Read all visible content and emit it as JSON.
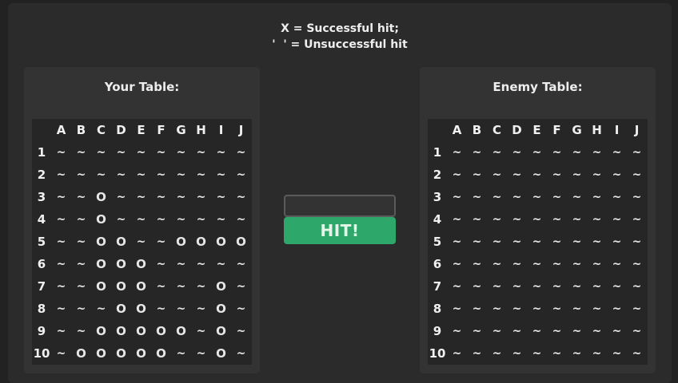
{
  "legend": {
    "line1": "X = Successful hit;",
    "line2": "'  ' = Unsuccessful hit"
  },
  "columns": [
    "A",
    "B",
    "C",
    "D",
    "E",
    "F",
    "G",
    "H",
    "I",
    "J"
  ],
  "rows": [
    "1",
    "2",
    "3",
    "4",
    "5",
    "6",
    "7",
    "8",
    "9",
    "10"
  ],
  "your_table": {
    "title": "Your Table:",
    "grid": [
      [
        "~",
        "~",
        "~",
        "~",
        "~",
        "~",
        "~",
        "~",
        "~",
        "~"
      ],
      [
        "~",
        "~",
        "~",
        "~",
        "~",
        "~",
        "~",
        "~",
        "~",
        "~"
      ],
      [
        "~",
        "~",
        "O",
        "~",
        "~",
        "~",
        "~",
        "~",
        "~",
        "~"
      ],
      [
        "~",
        "~",
        "O",
        "~",
        "~",
        "~",
        "~",
        "~",
        "~",
        "~"
      ],
      [
        "~",
        "~",
        "O",
        "O",
        "~",
        "~",
        "O",
        "O",
        "O",
        "O"
      ],
      [
        "~",
        "~",
        "O",
        "O",
        "O",
        "~",
        "~",
        "~",
        "~",
        "~"
      ],
      [
        "~",
        "~",
        "O",
        "O",
        "O",
        "~",
        "~",
        "~",
        "O",
        "~"
      ],
      [
        "~",
        "~",
        "~",
        "O",
        "O",
        "~",
        "~",
        "~",
        "O",
        "~"
      ],
      [
        "~",
        "~",
        "O",
        "O",
        "O",
        "O",
        "O",
        "~",
        "O",
        "~"
      ],
      [
        "~",
        "O",
        "O",
        "O",
        "O",
        "O",
        "~",
        "~",
        "O",
        "~"
      ]
    ]
  },
  "enemy_table": {
    "title": "Enemy Table:",
    "grid": [
      [
        "~",
        "~",
        "~",
        "~",
        "~",
        "~",
        "~",
        "~",
        "~",
        "~"
      ],
      [
        "~",
        "~",
        "~",
        "~",
        "~",
        "~",
        "~",
        "~",
        "~",
        "~"
      ],
      [
        "~",
        "~",
        "~",
        "~",
        "~",
        "~",
        "~",
        "~",
        "~",
        "~"
      ],
      [
        "~",
        "~",
        "~",
        "~",
        "~",
        "~",
        "~",
        "~",
        "~",
        "~"
      ],
      [
        "~",
        "~",
        "~",
        "~",
        "~",
        "~",
        "~",
        "~",
        "~",
        "~"
      ],
      [
        "~",
        "~",
        "~",
        "~",
        "~",
        "~",
        "~",
        "~",
        "~",
        "~"
      ],
      [
        "~",
        "~",
        "~",
        "~",
        "~",
        "~",
        "~",
        "~",
        "~",
        "~"
      ],
      [
        "~",
        "~",
        "~",
        "~",
        "~",
        "~",
        "~",
        "~",
        "~",
        "~"
      ],
      [
        "~",
        "~",
        "~",
        "~",
        "~",
        "~",
        "~",
        "~",
        "~",
        "~"
      ],
      [
        "~",
        "~",
        "~",
        "~",
        "~",
        "~",
        "~",
        "~",
        "~",
        "~"
      ]
    ]
  },
  "controls": {
    "input_value": "",
    "input_placeholder": "",
    "hit_label": "HIT!",
    "button_color": "#2ea86a"
  }
}
